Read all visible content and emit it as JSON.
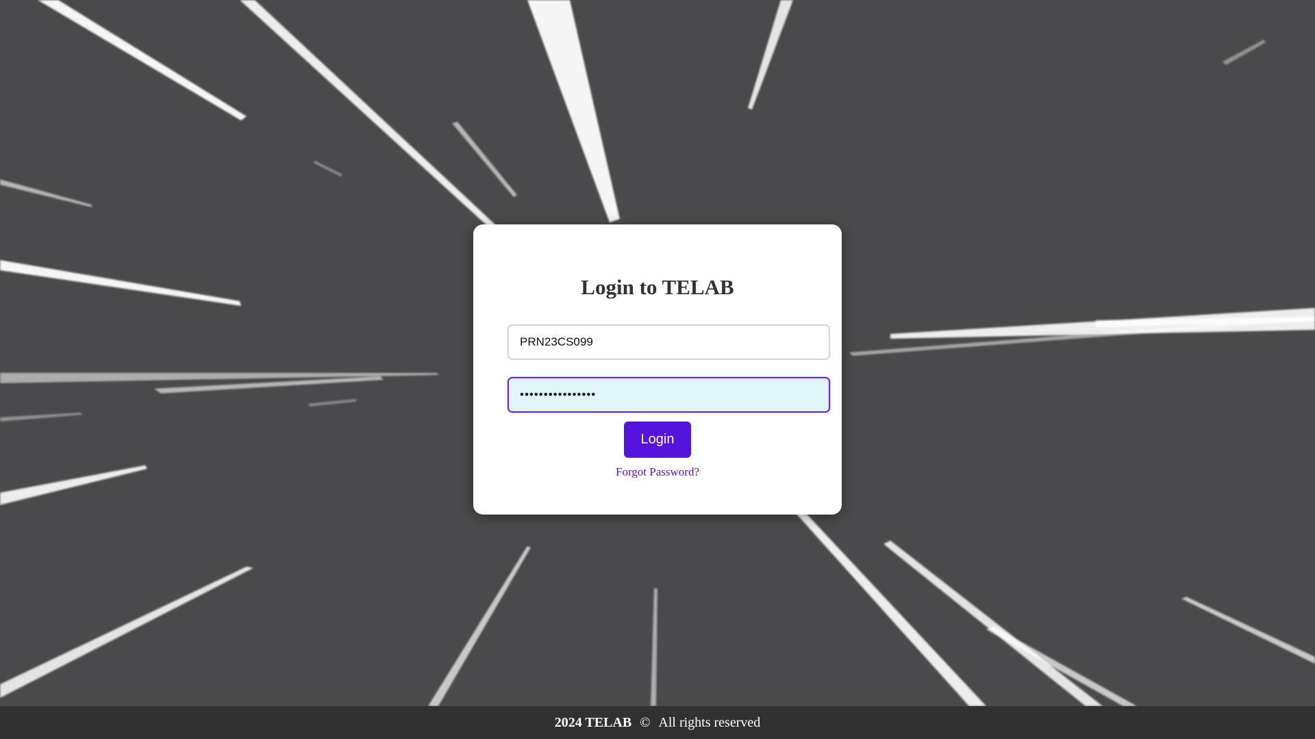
{
  "login": {
    "title": "Login to TELAB",
    "username_value": "PRN23CS099",
    "password_value": "................",
    "button_label": "Login",
    "forgot_link": "Forgot Password?"
  },
  "footer": {
    "year_brand": "2024 TELAB",
    "copyright_symbol": "©",
    "rights_text": "All rights reserved"
  },
  "colors": {
    "background": "#4a494b",
    "accent": "#5514dc",
    "footer_bg": "#313131"
  }
}
